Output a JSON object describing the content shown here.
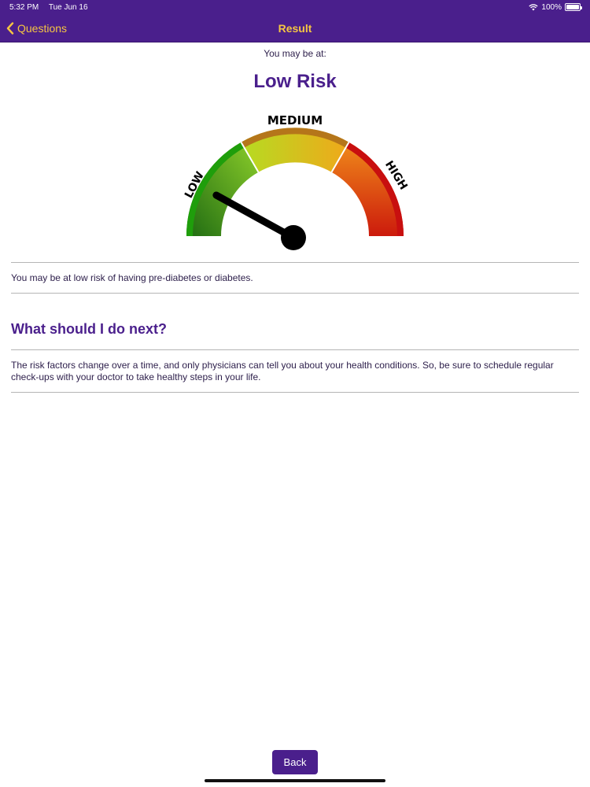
{
  "status_bar": {
    "time": "5:32 PM",
    "date": "Tue Jun 16",
    "battery": "100%"
  },
  "nav": {
    "back_label": "Questions",
    "title": "Result"
  },
  "result": {
    "intro": "You may be at:",
    "risk_level": "Low Risk",
    "summary": "You may be at low risk of having pre-diabetes or diabetes."
  },
  "gauge": {
    "labels": {
      "low": "LOW",
      "medium": "MEDIUM",
      "high": "HIGH"
    },
    "needle_level": 0.16,
    "colors": {
      "low": "#2a9a12",
      "medium": "#d9c020",
      "high": "#d2150d",
      "needle": "#000000"
    }
  },
  "next_steps": {
    "heading": "What should I do next?",
    "text": "The risk factors change over a time, and only physicians can tell you about your health conditions. So, be sure to schedule regular check-ups with your doctor to take healthy steps in your life."
  },
  "footer": {
    "back_label": "Back"
  },
  "colors": {
    "primary": "#4a1f8c",
    "accent": "#f5c542"
  }
}
